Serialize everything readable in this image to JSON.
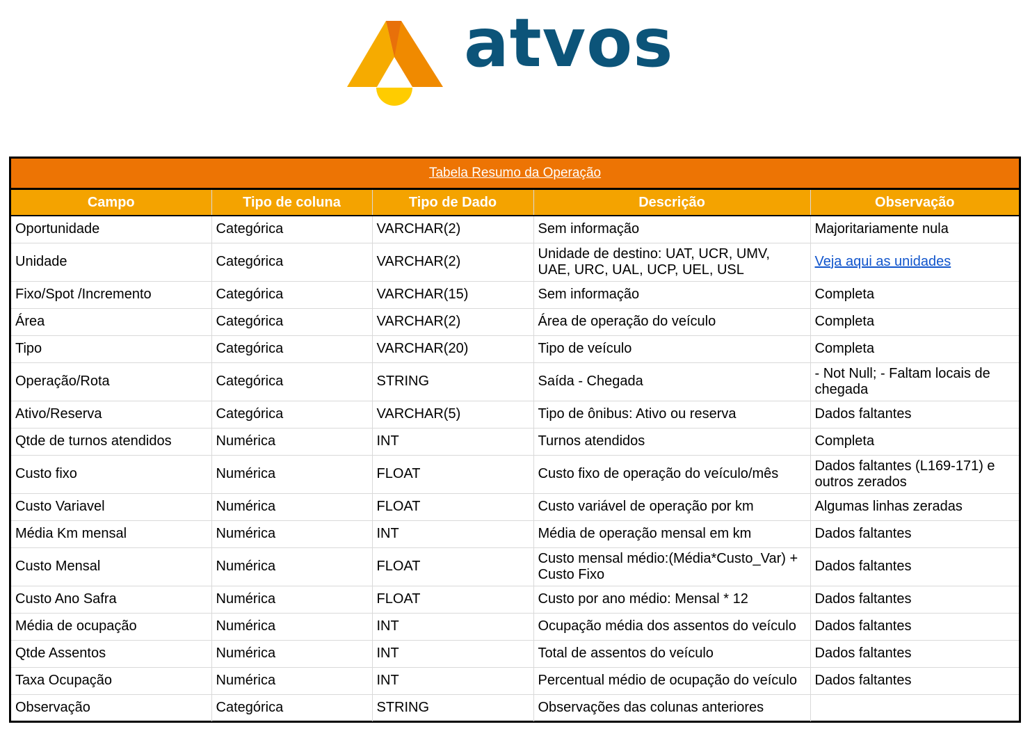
{
  "logo": {
    "text": "atvos",
    "colors": {
      "orange_dark": "#e8700a",
      "orange": "#f29200",
      "amber": "#f6ab00",
      "yellow": "#ffcc00",
      "text": "#0c5479"
    }
  },
  "table": {
    "title": "Tabela Resumo da Operação",
    "headers": [
      "Campo",
      "Tipo de coluna",
      "Tipo de Dado",
      "Descrição",
      "Observação"
    ],
    "rows": [
      {
        "campo": "Oportunidade",
        "tipo_coluna": "Categórica",
        "tipo_dado": "VARCHAR(2)",
        "descricao": "Sem informação",
        "observacao": "Majoritariamente nula"
      },
      {
        "campo": "Unidade",
        "tipo_coluna": "Categórica",
        "tipo_dado": "VARCHAR(2)",
        "descricao": "Unidade de destino: UAT, UCR, UMV, UAE, URC, UAL, UCP, UEL, USL",
        "observacao": "Veja aqui as unidades"
      },
      {
        "campo": "Fixo/Spot /Incremento",
        "tipo_coluna": "Categórica",
        "tipo_dado": "VARCHAR(15)",
        "descricao": "Sem informação",
        "observacao": "Completa"
      },
      {
        "campo": "Área",
        "tipo_coluna": "Categórica",
        "tipo_dado": "VARCHAR(2)",
        "descricao": "Área de operação do veículo",
        "observacao": "Completa"
      },
      {
        "campo": "Tipo",
        "tipo_coluna": "Categórica",
        "tipo_dado": "VARCHAR(20)",
        "descricao": "Tipo de veículo",
        "observacao": "Completa"
      },
      {
        "campo": "Operação/Rota",
        "tipo_coluna": "Categórica",
        "tipo_dado": "STRING",
        "descricao": "Saída - Chegada",
        "observacao": "- Not Null; - Faltam locais de chegada"
      },
      {
        "campo": "Ativo/Reserva",
        "tipo_coluna": "Categórica",
        "tipo_dado": "VARCHAR(5)",
        "descricao": "Tipo de ônibus: Ativo ou reserva",
        "observacao": "Dados faltantes"
      },
      {
        "campo": "Qtde de turnos atendidos",
        "tipo_coluna": "Numérica",
        "tipo_dado": "INT",
        "descricao": "Turnos atendidos",
        "observacao": "Completa"
      },
      {
        "campo": "Custo fixo",
        "tipo_coluna": "Numérica",
        "tipo_dado": "FLOAT",
        "descricao": "Custo fixo de operação do veículo/mês",
        "observacao": "Dados faltantes (L169-171) e outros zerados"
      },
      {
        "campo": "Custo Variavel",
        "tipo_coluna": "Numérica",
        "tipo_dado": "FLOAT",
        "descricao": "Custo variável de operação por km",
        "observacao": "Algumas linhas zeradas"
      },
      {
        "campo": "Média Km mensal",
        "tipo_coluna": "Numérica",
        "tipo_dado": "INT",
        "descricao": "Média de operação mensal em km",
        "observacao": "Dados faltantes"
      },
      {
        "campo": "Custo Mensal",
        "tipo_coluna": "Numérica",
        "tipo_dado": "FLOAT",
        "descricao": "Custo mensal médio:(Média*Custo_Var) + Custo Fixo",
        "observacao": "Dados faltantes"
      },
      {
        "campo": "Custo Ano Safra",
        "tipo_coluna": "Numérica",
        "tipo_dado": "FLOAT",
        "descricao": "Custo por ano médio: Mensal * 12",
        "observacao": "Dados faltantes"
      },
      {
        "campo": "Média de ocupação",
        "tipo_coluna": "Numérica",
        "tipo_dado": "INT",
        "descricao": "Ocupação média dos assentos do veículo",
        "observacao": "Dados faltantes"
      },
      {
        "campo": "Qtde Assentos",
        "tipo_coluna": "Numérica",
        "tipo_dado": "INT",
        "descricao": "Total de assentos do veículo",
        "observacao": "Dados faltantes"
      },
      {
        "campo": "Taxa Ocupação",
        "tipo_coluna": "Numérica",
        "tipo_dado": "INT",
        "descricao": "Percentual médio de ocupação do veículo",
        "observacao": "Dados faltantes"
      },
      {
        "campo": "Observação",
        "tipo_coluna": "Categórica",
        "tipo_dado": "STRING",
        "descricao": "Observações das colunas anteriores",
        "observacao": ""
      }
    ]
  }
}
